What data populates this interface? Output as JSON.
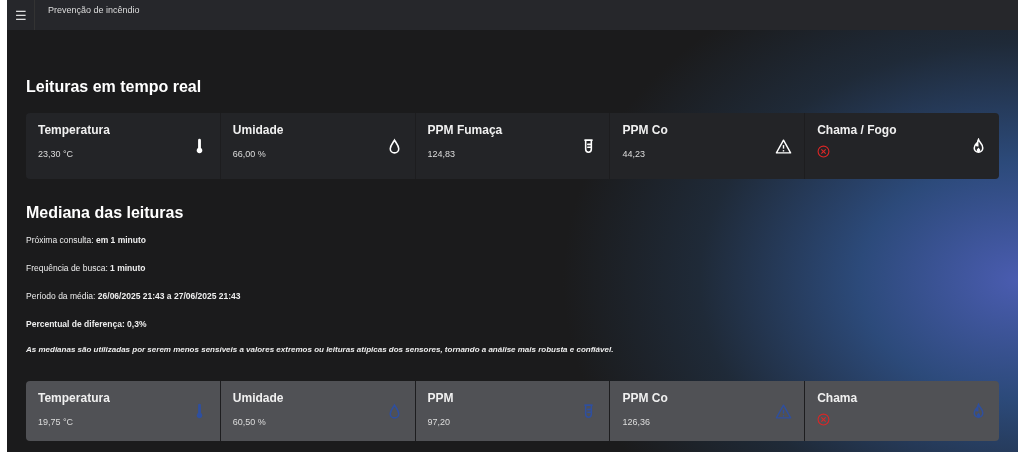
{
  "app_bar": {
    "menu_icon": "☰",
    "title": "Prevenção de incêndio"
  },
  "realtime": {
    "title": "Leituras em tempo real",
    "cards": [
      {
        "label": "Temperatura",
        "kind": "value",
        "value": "23,30 °C"
      },
      {
        "label": "Umidade",
        "kind": "value",
        "value": "66,00 %"
      },
      {
        "label": "PPM Fumaça",
        "kind": "value",
        "value": "124,83"
      },
      {
        "label": "PPM Co",
        "kind": "value",
        "value": "44,23"
      },
      {
        "label": "Chama / Fogo",
        "kind": "status",
        "detected": false
      }
    ]
  },
  "median": {
    "title": "Mediana das leituras",
    "lines": [
      "Próxima consulta: **em 1 minuto**",
      "Frequência de busca: **1 minuto**",
      "Período da média: **26/06/2025 21:43 a 27/06/2025 21:43**",
      "**Percentual de diferença: 0,3%**"
    ],
    "note": "As medianas são utilizadas por serem menos sensíveis a valores extremos ou leituras atípicas dos sensores, tornando a análise mais robusta e confiável.",
    "cards": [
      {
        "label": "Temperatura",
        "kind": "value",
        "value": "19,75 °C"
      },
      {
        "label": "Umidade",
        "kind": "value",
        "value": "60,50 %"
      },
      {
        "label": "PPM",
        "kind": "value",
        "value": "97,20"
      },
      {
        "label": "PPM Co",
        "kind": "value",
        "value": "126,36"
      },
      {
        "label": "Chama",
        "kind": "status",
        "detected": false
      }
    ]
  }
}
